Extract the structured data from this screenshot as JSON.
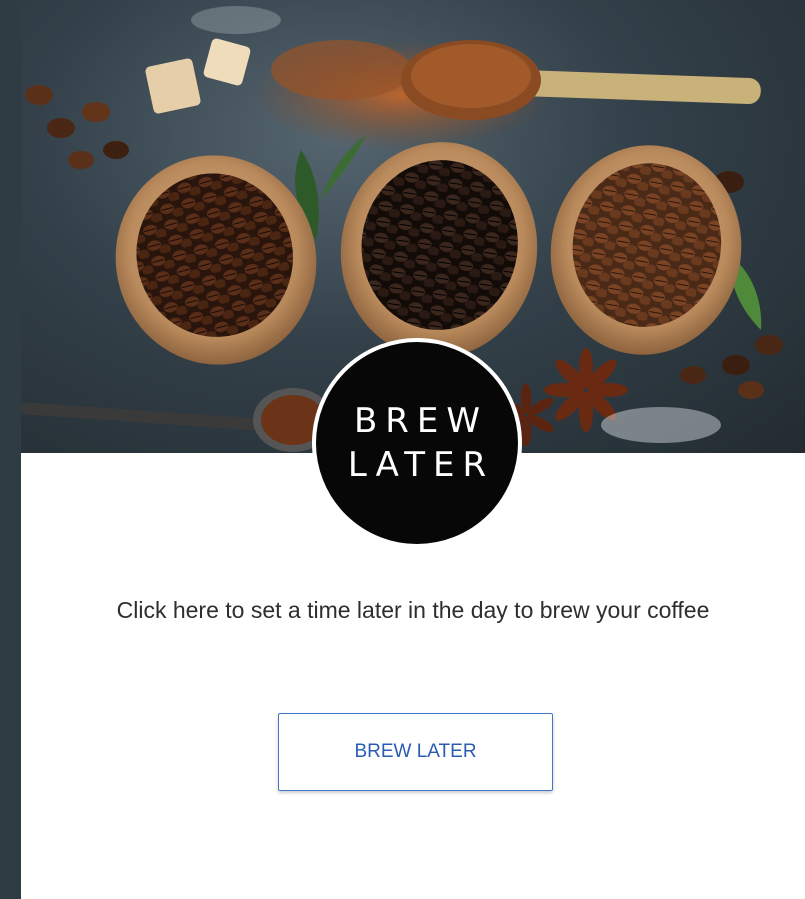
{
  "hero": {
    "logo_line1": "BREW",
    "logo_line2": "LATER"
  },
  "description": "Click here to set a time later in the day to brew your coffee",
  "cta": {
    "label": "BREW LATER"
  },
  "colors": {
    "rail": "#2f3c44",
    "logo_bg": "#070707",
    "button_border": "#3f78c8",
    "button_text": "#2a5db0",
    "text": "#2e2e2e"
  }
}
